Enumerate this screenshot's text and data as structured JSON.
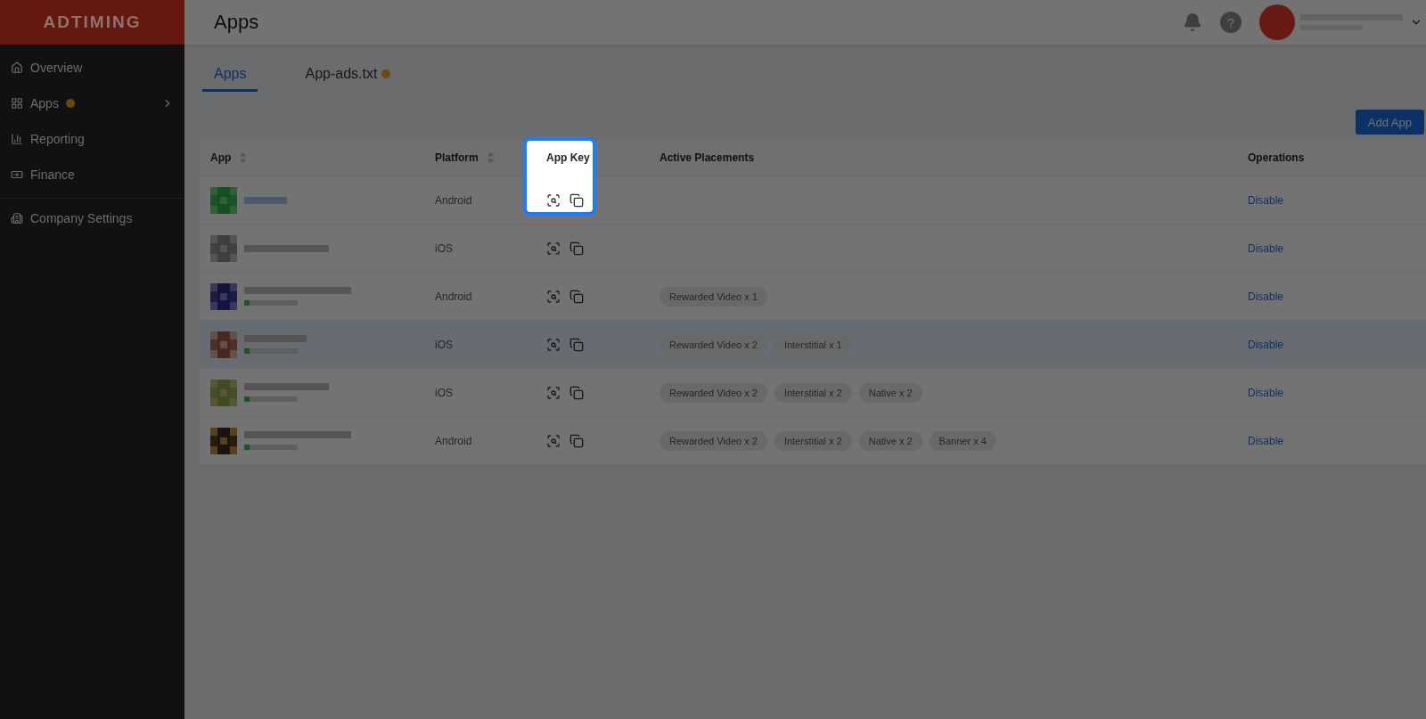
{
  "sidebar": {
    "logo": "ADTIMING",
    "items": [
      {
        "label": "Overview",
        "selected": false,
        "badge": false,
        "submenu": false,
        "divider_before": false
      },
      {
        "label": "Apps",
        "selected": false,
        "badge": true,
        "submenu": true,
        "divider_before": false
      },
      {
        "label": "Reporting",
        "selected": false,
        "badge": false,
        "submenu": false,
        "divider_before": false
      },
      {
        "label": "Finance",
        "selected": false,
        "badge": false,
        "submenu": false,
        "divider_before": false
      },
      {
        "label": "Company Settings",
        "selected": false,
        "badge": false,
        "submenu": false,
        "divider_before": true
      }
    ]
  },
  "header": {
    "title": "Apps",
    "help": "?"
  },
  "tabs": [
    {
      "label": "Apps",
      "selected": true,
      "badge": false
    },
    {
      "label": "App-ads.txt",
      "selected": false,
      "badge": true
    }
  ],
  "add_button": "Add App",
  "table": {
    "columns": [
      {
        "label": "App",
        "sortable": true,
        "spotlight": false
      },
      {
        "label": "Platform",
        "sortable": true,
        "spotlight": false
      },
      {
        "label": "App Key",
        "sortable": false,
        "spotlight": true
      },
      {
        "label": "Active Placements",
        "sortable": false,
        "spotlight": false
      },
      {
        "label": "Operations",
        "sortable": false,
        "spotlight": false
      }
    ],
    "rows": [
      {
        "platform": "Android",
        "placements": [],
        "operation": "Disable",
        "highlighted": false
      },
      {
        "platform": "iOS",
        "placements": [],
        "operation": "Disable",
        "highlighted": false
      },
      {
        "platform": "Android",
        "placements": [
          "Rewarded Video x 1"
        ],
        "operation": "Disable",
        "highlighted": false
      },
      {
        "platform": "iOS",
        "placements": [
          "Rewarded Video x 2",
          "Interstitial x 1"
        ],
        "operation": "Disable",
        "highlighted": true
      },
      {
        "platform": "iOS",
        "placements": [
          "Rewarded Video x 2",
          "Interstitial x 2",
          "Native x 2"
        ],
        "operation": "Disable",
        "highlighted": false
      },
      {
        "platform": "Android",
        "placements": [
          "Rewarded Video x 2",
          "Interstitial x 2",
          "Native x 2",
          "Banner x 4"
        ],
        "operation": "Disable",
        "highlighted": false
      }
    ]
  }
}
